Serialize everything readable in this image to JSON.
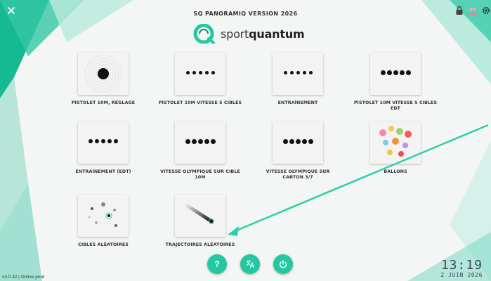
{
  "header": {
    "title": "SQ PANORAMIQ VERSION 2026",
    "logo_text_light": "sport",
    "logo_text_bold": "quantum"
  },
  "colors": {
    "accent": "#23c7a2",
    "arrow": "#2bcfaa",
    "text": "#333333"
  },
  "icons": {
    "close": "close-icon",
    "lock": "lock-icon",
    "users": "users-icon",
    "settings": "gear-icon"
  },
  "tiles": [
    {
      "label": "PISTOLET 10M, RÉGLAGE",
      "icon": "target-icon"
    },
    {
      "label": "PISTOLET 10M VITESSE 5 CIBLES",
      "icon": "five-dots-icon"
    },
    {
      "label": "ENTRAÎNEMENT",
      "icon": "five-dots-icon"
    },
    {
      "label": "PISTOLET 10M VITESSE 5 CIBLES EDT",
      "icon": "five-dots-bold-icon"
    },
    {
      "label": "ENTRAÎNEMENT (EDT)",
      "icon": "five-dots-icon"
    },
    {
      "label": "VITESSE OLYMPIQUE SUR CIBLE 10M",
      "icon": "five-dots-bold-icon"
    },
    {
      "label": "VITESSE OLYMPIQUE SUR CARTON 3/7",
      "icon": "five-dots-bold-icon"
    },
    {
      "label": "BALLONS",
      "icon": "balloons-icon"
    },
    {
      "label": "CIBLES ALÉATOIRES",
      "icon": "random-targets-icon"
    },
    {
      "label": "TRAJECTOIRES ALÉATOIRES",
      "icon": "trajectory-icon"
    }
  ],
  "bottom_buttons": [
    {
      "label": "?",
      "icon": "help-icon"
    },
    {
      "label": "",
      "icon": "translate-icon"
    },
    {
      "label": "",
      "icon": "power-icon"
    }
  ],
  "status": {
    "version": "v3.0.32 | Online prod",
    "time": "13:19",
    "date": "2 JUIN 2026"
  }
}
